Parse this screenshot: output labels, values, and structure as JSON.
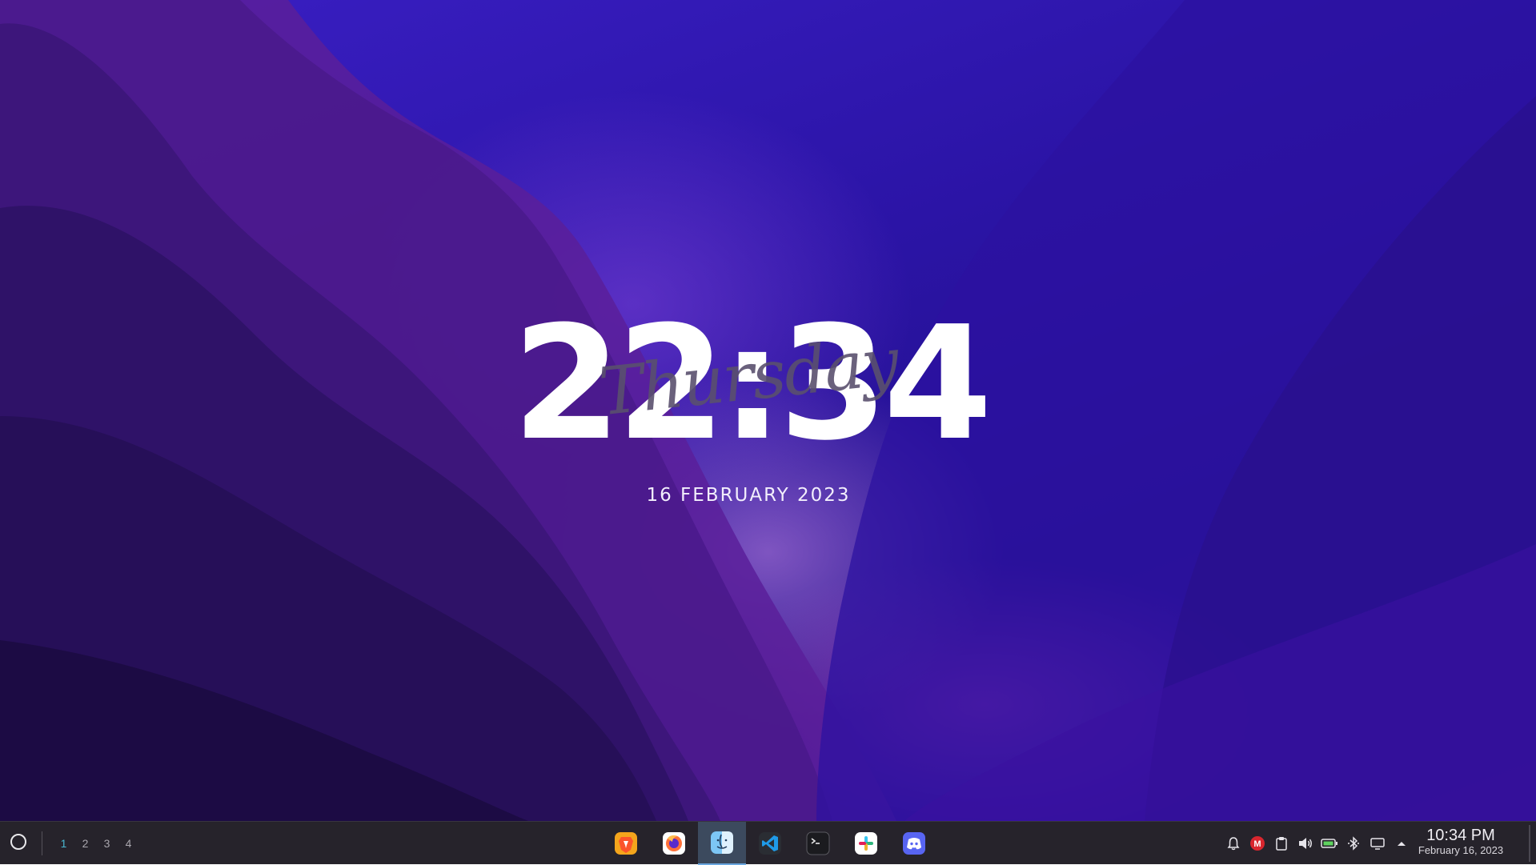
{
  "widget": {
    "time": "22:34",
    "day": "Thursday",
    "date": "16 FEBRUARY 2023"
  },
  "taskbar": {
    "start_icon": "circle-launcher-icon",
    "workspaces": [
      "1",
      "2",
      "3",
      "4"
    ],
    "active_workspace": "1",
    "dock": [
      {
        "name": "brave-icon"
      },
      {
        "name": "firefox-icon"
      },
      {
        "name": "finder-icon",
        "active": true
      },
      {
        "name": "vscode-icon"
      },
      {
        "name": "terminal-icon"
      },
      {
        "name": "slack-icon"
      },
      {
        "name": "discord-icon"
      }
    ],
    "tray": [
      {
        "name": "notification-bell-icon"
      },
      {
        "name": "mail-icon",
        "label": "M"
      },
      {
        "name": "clipboard-icon"
      },
      {
        "name": "volume-icon"
      },
      {
        "name": "battery-icon"
      },
      {
        "name": "bluetooth-icon"
      },
      {
        "name": "display-icon"
      },
      {
        "name": "tray-expand-icon"
      }
    ],
    "clock_time": "10:34 PM",
    "clock_date": "February 16, 2023"
  },
  "colors": {
    "taskbar_bg": "#26232b",
    "active_workspace": "#49b6cf",
    "wallpaper_main": "#2b14a6"
  }
}
